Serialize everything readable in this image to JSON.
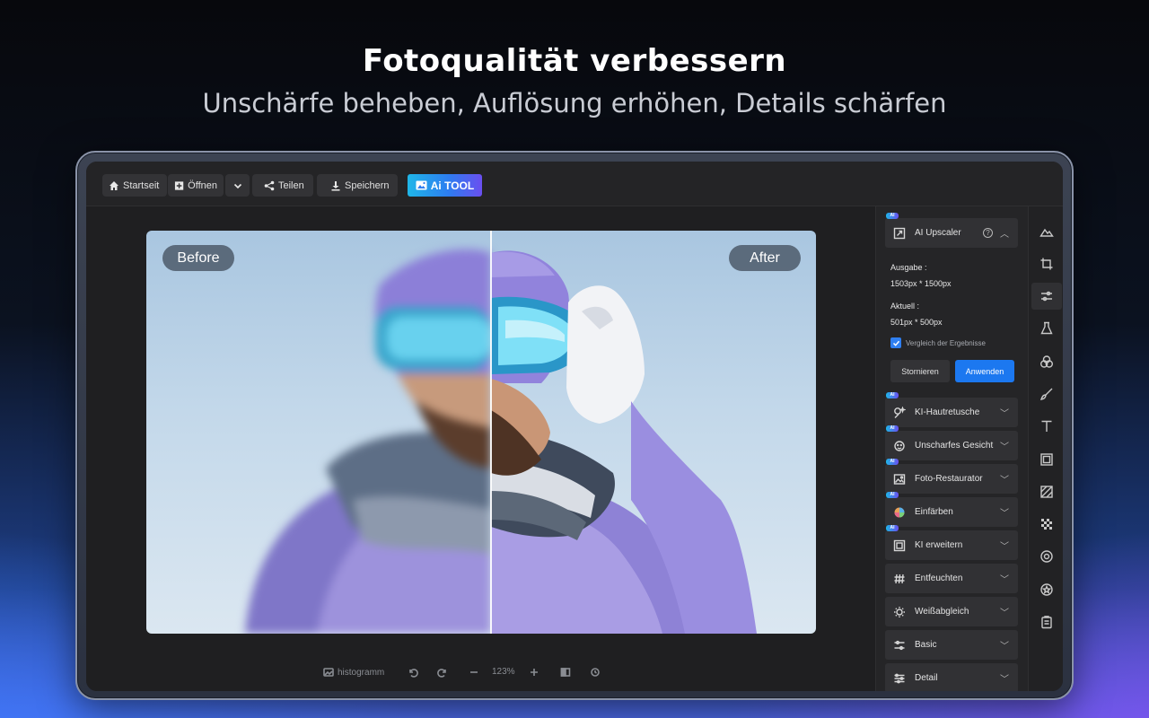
{
  "hero": {
    "title": "Fotoqualität verbessern",
    "subtitle": "Unschärfe beheben, Auflösung erhöhen, Details schärfen"
  },
  "toolbar": {
    "home_label": "Startseit",
    "open_label": "Öffnen",
    "share_label": "Teilen",
    "save_label": "Speichern",
    "ai_tool_label": "Ai TOOL"
  },
  "canvas": {
    "before_label": "Before",
    "after_label": "After"
  },
  "statusbar": {
    "histogram_label": "histogramm",
    "zoom_value": "123%"
  },
  "panel": {
    "ai_badge": "AI",
    "upscaler": {
      "label": "AI Upscaler",
      "output_label": "Ausgabe :",
      "output_value": "1503px * 1500px",
      "current_label": "Aktuell :",
      "current_value": "501px * 500px",
      "compare_label": "Vergleich der Ergebnisse",
      "compare_checked": true,
      "cancel_label": "Stornieren",
      "apply_label": "Anwenden"
    },
    "items": [
      {
        "label": "KI-Hautretusche",
        "ai": true
      },
      {
        "label": "Unscharfes Gesicht",
        "ai": true
      },
      {
        "label": "Foto-Restaurator",
        "ai": true
      },
      {
        "label": "Einfärben",
        "ai": true
      },
      {
        "label": "KI erweitern",
        "ai": true
      },
      {
        "label": "Entfeuchten",
        "ai": false
      },
      {
        "label": "Weißabgleich",
        "ai": false
      },
      {
        "label": "Basic",
        "ai": false
      },
      {
        "label": "Detail",
        "ai": false
      }
    ]
  },
  "rail": {
    "icons": [
      "landscape-icon",
      "crop-icon",
      "adjust-sliders-icon",
      "flask-icon",
      "color-circles-icon",
      "brush-icon",
      "text-icon",
      "frame-icon",
      "texture-icon",
      "mosaic-icon",
      "focus-icon",
      "sticker-icon",
      "clipboard-icon"
    ],
    "active_index": 2
  },
  "colors": {
    "accent": "#1c78f0",
    "ai_gradient_start": "#1fb6e8",
    "ai_gradient_end": "#6a4ff0"
  }
}
